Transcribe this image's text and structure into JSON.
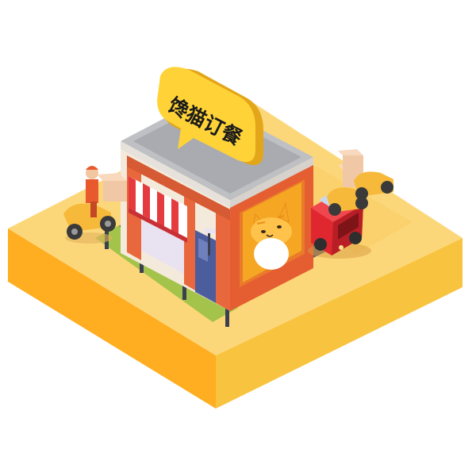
{
  "sign": {
    "text": "馋猫订餐"
  },
  "colors": {
    "platform_top": "#FCD77A",
    "platform_left": "#FFAE22",
    "platform_right": "#F6C23F",
    "brick": "#E9673C",
    "wall_cream": "#F4EADB",
    "sign_yellow": "#FFD337",
    "awning_red": "#E53B3F",
    "glass": "#4C5D9D",
    "lawn": "#A4C34A",
    "car_red": "#E0272F",
    "scooter": "#F6B93A",
    "cat_orange": "#F5A623",
    "roof_gray": "#BFC0C3"
  },
  "icons": {
    "sign": "speech-bubble-sign",
    "poster": "cat-face-poster",
    "vehicle": "red-car",
    "delivery": "delivery-scooter"
  }
}
